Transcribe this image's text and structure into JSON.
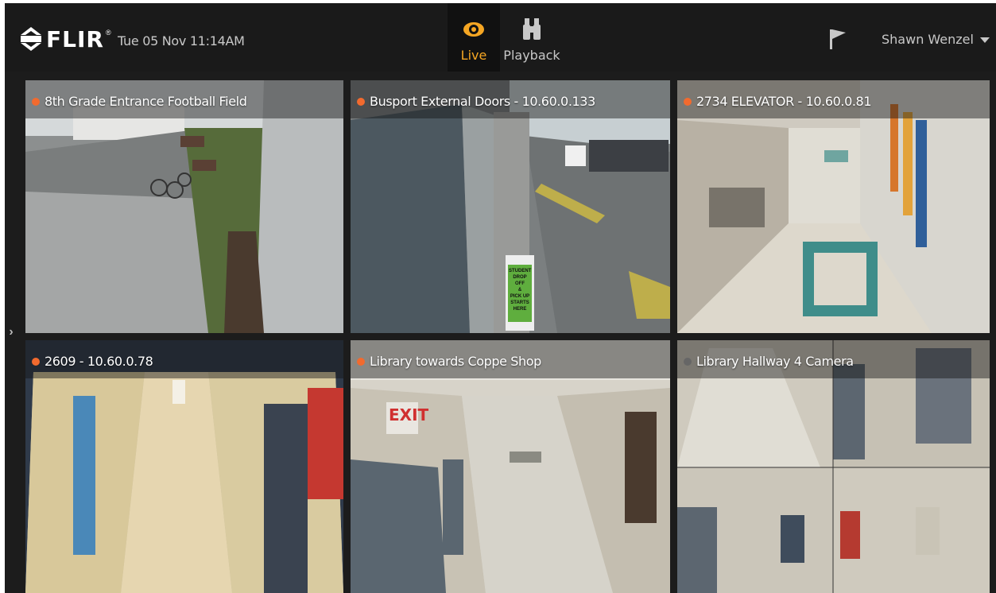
{
  "header": {
    "logo_text": "FLIR",
    "logo_reg": "®",
    "datetime": "Tue 05 Nov 11:14AM",
    "nav": [
      {
        "label": "Live",
        "icon": "eye-icon",
        "active": true
      },
      {
        "label": "Playback",
        "icon": "binoculars-icon",
        "active": false
      }
    ],
    "flag_icon": "flag-icon",
    "user_name": "Shawn Wenzel"
  },
  "colors": {
    "accent": "#f5a623",
    "recording_dot": "#f26a2e",
    "background": "#1c1c1c"
  },
  "cameras": [
    {
      "title": "8th Grade Entrance Football Field",
      "status": "recording"
    },
    {
      "title": "Busport External Doors - 10.60.0.133",
      "status": "recording"
    },
    {
      "title": "2734 ELEVATOR - 10.60.0.81",
      "status": "recording"
    },
    {
      "title": "2609 - 10.60.0.78",
      "status": "recording"
    },
    {
      "title": "Library towards Coppe Shop",
      "status": "recording"
    },
    {
      "title": "Library Hallway 4 Camera",
      "status": "idle"
    }
  ],
  "scene_text": {
    "sign_lines": [
      "STUDENT",
      "DROP OFF",
      "&",
      "PICK UP",
      "STARTS HERE"
    ],
    "exit_sign": "EXIT"
  }
}
